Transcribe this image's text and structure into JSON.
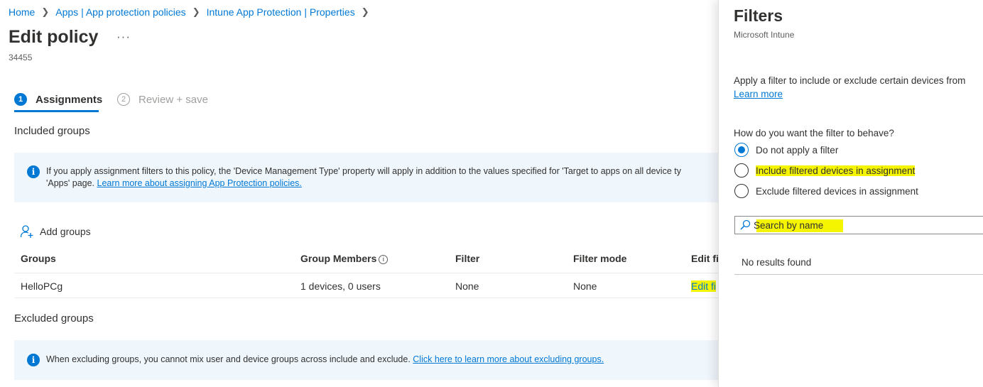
{
  "breadcrumb": {
    "items": [
      "Home",
      "Apps | App protection policies",
      "Intune App Protection | Properties"
    ]
  },
  "page": {
    "title": "Edit policy",
    "more_label": "···",
    "subtitle": "34455"
  },
  "steps": [
    {
      "number": "1",
      "label": "Assignments",
      "active": true
    },
    {
      "number": "2",
      "label": "Review + save",
      "active": false
    }
  ],
  "included": {
    "title": "Included groups",
    "info_text_1": "If you apply assignment filters to this policy, the 'Device Management Type' property will apply in addition to the values specified for 'Target to apps on all device ty",
    "info_text_2_prefix": "'Apps' page. ",
    "info_link": "Learn more about assigning App Protection policies.",
    "add_groups_label": "Add groups",
    "columns": [
      "Groups",
      "Group Members",
      "Filter",
      "Filter mode",
      "Edit fi"
    ],
    "rows": [
      {
        "group": "HelloPCg",
        "members": "1 devices, 0 users",
        "filter": "None",
        "filter_mode": "None",
        "edit": "Edit fi"
      }
    ]
  },
  "excluded": {
    "title": "Excluded groups",
    "info_text": "When excluding groups, you cannot mix user and device groups across include and exclude. ",
    "info_link": "Click here to learn more about excluding groups."
  },
  "panel": {
    "title": "Filters",
    "subtitle": "Microsoft Intune",
    "description": "Apply a filter to include or exclude certain devices from",
    "learn_more": "Learn more",
    "question": "How do you want the filter to behave?",
    "options": [
      {
        "label": "Do not apply a filter",
        "checked": true
      },
      {
        "label": "Include filtered devices in assignment",
        "checked": false
      },
      {
        "label": "Exclude filtered devices in assignment",
        "checked": false
      }
    ],
    "search_placeholder": "Search by name",
    "no_results": "No results found"
  },
  "colors": {
    "accent": "#0078d4",
    "highlight": "#f5f500",
    "info_background": "#eff6fc"
  }
}
